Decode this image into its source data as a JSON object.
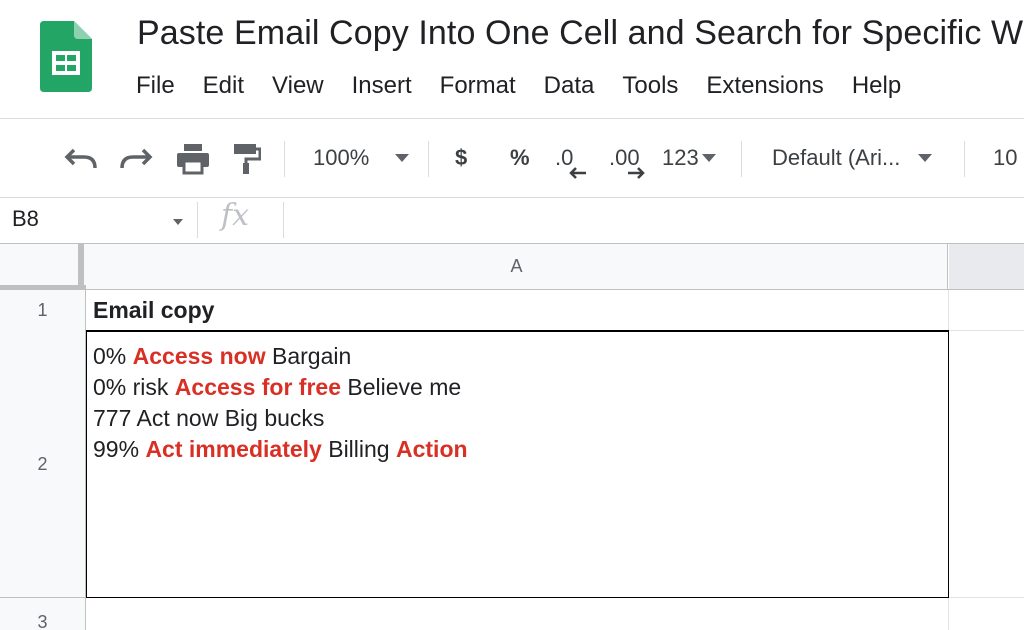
{
  "window": {
    "doc_title": "Paste Email Copy Into One Cell and Search for Specific Words"
  },
  "menu": [
    "File",
    "Edit",
    "View",
    "Insert",
    "Format",
    "Data",
    "Tools",
    "Extensions",
    "Help"
  ],
  "toolbar": {
    "zoom": "100%",
    "currency_label": "$",
    "percent_label": "%",
    "decrease_decimal_label": ".0",
    "increase_decimal_label": ".00",
    "more_formats_label": "123",
    "font_name": "Default (Ari...",
    "font_size": "10"
  },
  "formula_bar": {
    "name_box": "B8",
    "fx_label": "fx"
  },
  "grid": {
    "column_headers": [
      "A"
    ],
    "row_headers": [
      "1",
      "2",
      "3"
    ],
    "a1": "Email copy",
    "a2_lines": [
      [
        {
          "t": "0% "
        },
        {
          "t": "Access now",
          "hl": true
        },
        {
          "t": " Bargain"
        }
      ],
      [
        {
          "t": "0% risk "
        },
        {
          "t": "Access for free",
          "hl": true
        },
        {
          "t": " Believe me"
        }
      ],
      [
        {
          "t": "777 Act now Big bucks"
        }
      ],
      [
        {
          "t": "99% "
        },
        {
          "t": "Act immediately",
          "hl": true
        },
        {
          "t": " Billing "
        },
        {
          "t": "Action",
          "hl": true
        }
      ]
    ]
  },
  "colors": {
    "logo_green": "#23a566",
    "highlight_red": "#d93025",
    "header_gray": "#f8f9fa"
  }
}
